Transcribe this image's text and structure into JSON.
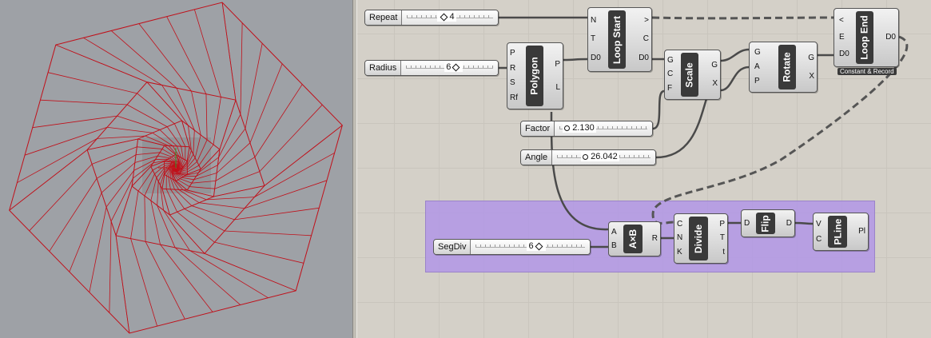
{
  "sliders": {
    "repeat": {
      "name": "Repeat",
      "value": "4"
    },
    "radius": {
      "name": "Radius",
      "value": "6"
    },
    "factor": {
      "name": "Factor",
      "value": "2.130"
    },
    "angle": {
      "name": "Angle",
      "value": "26.042"
    },
    "segdiv": {
      "name": "SegDiv",
      "value": "6"
    }
  },
  "components": {
    "polygon": {
      "title": "Polygon",
      "inputs": [
        "P",
        "R",
        "S",
        "Rf"
      ],
      "outputs": [
        "P",
        "L"
      ]
    },
    "loop_start": {
      "title": "Loop Start",
      "inputs": [
        "N",
        "T",
        "D0"
      ],
      "outputs": [
        ">",
        "C",
        "D0"
      ]
    },
    "scale": {
      "title": "Scale",
      "inputs": [
        "G",
        "C",
        "F"
      ],
      "outputs": [
        "G",
        "X"
      ]
    },
    "rotate": {
      "title": "Rotate",
      "inputs": [
        "G",
        "A",
        "P"
      ],
      "outputs": [
        "G",
        "X"
      ]
    },
    "loop_end": {
      "title": "Loop End",
      "inputs": [
        "<",
        "E",
        "D0"
      ],
      "outputs": [
        "D0"
      ],
      "caption": "Constant & Record"
    },
    "axb": {
      "title": "A×B",
      "inputs": [
        "A",
        "B"
      ],
      "outputs": [
        "R"
      ]
    },
    "divide": {
      "title": "Divide",
      "inputs": [
        "C",
        "N",
        "K"
      ],
      "outputs": [
        "P",
        "T",
        "t"
      ]
    },
    "flip": {
      "title": "Flip",
      "inputs": [
        "D"
      ],
      "outputs": [
        "D"
      ]
    },
    "pline": {
      "title": "PLine",
      "inputs": [
        "V",
        "C"
      ],
      "outputs": [
        "Pl"
      ]
    }
  },
  "colors": {
    "viewport_bg": "#9ea1a6",
    "canvas_bg": "#d4d0c8",
    "geometry": "#c0101a",
    "group_fill": "#b296e6",
    "component_core": "#3a3a3a"
  }
}
